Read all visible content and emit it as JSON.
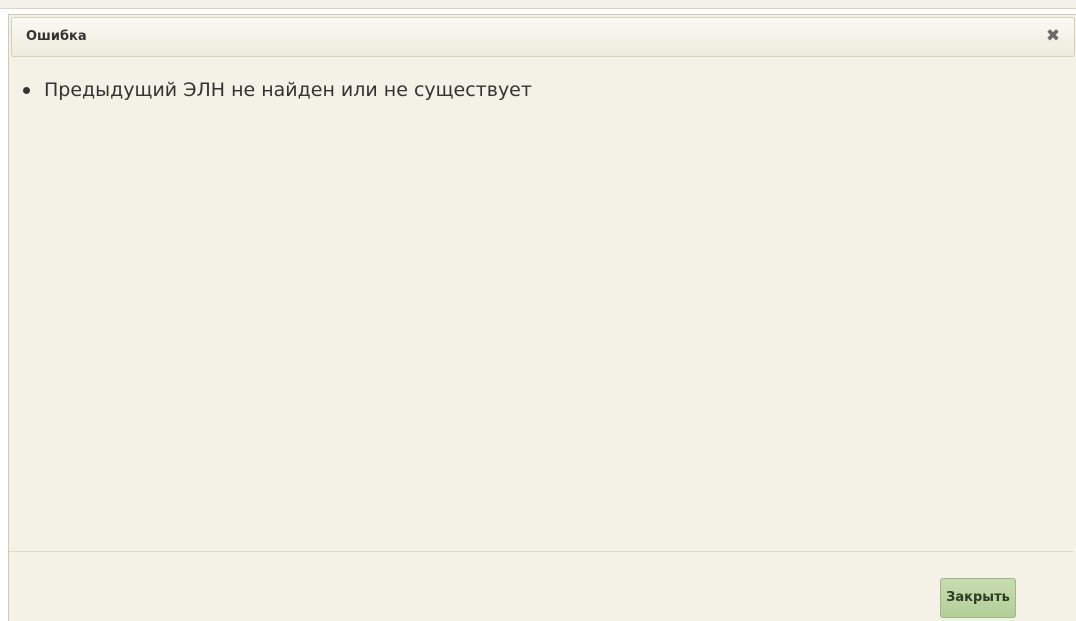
{
  "dialog": {
    "title": "Ошибка",
    "close_icon": "close-icon",
    "messages": [
      "Предыдущий ЭЛН не найден или не существует"
    ],
    "close_button_label": "Закрыть"
  },
  "colors": {
    "dialog_background": "#f4f2e6",
    "button_background": "#b9d49f",
    "text": "#333333"
  }
}
